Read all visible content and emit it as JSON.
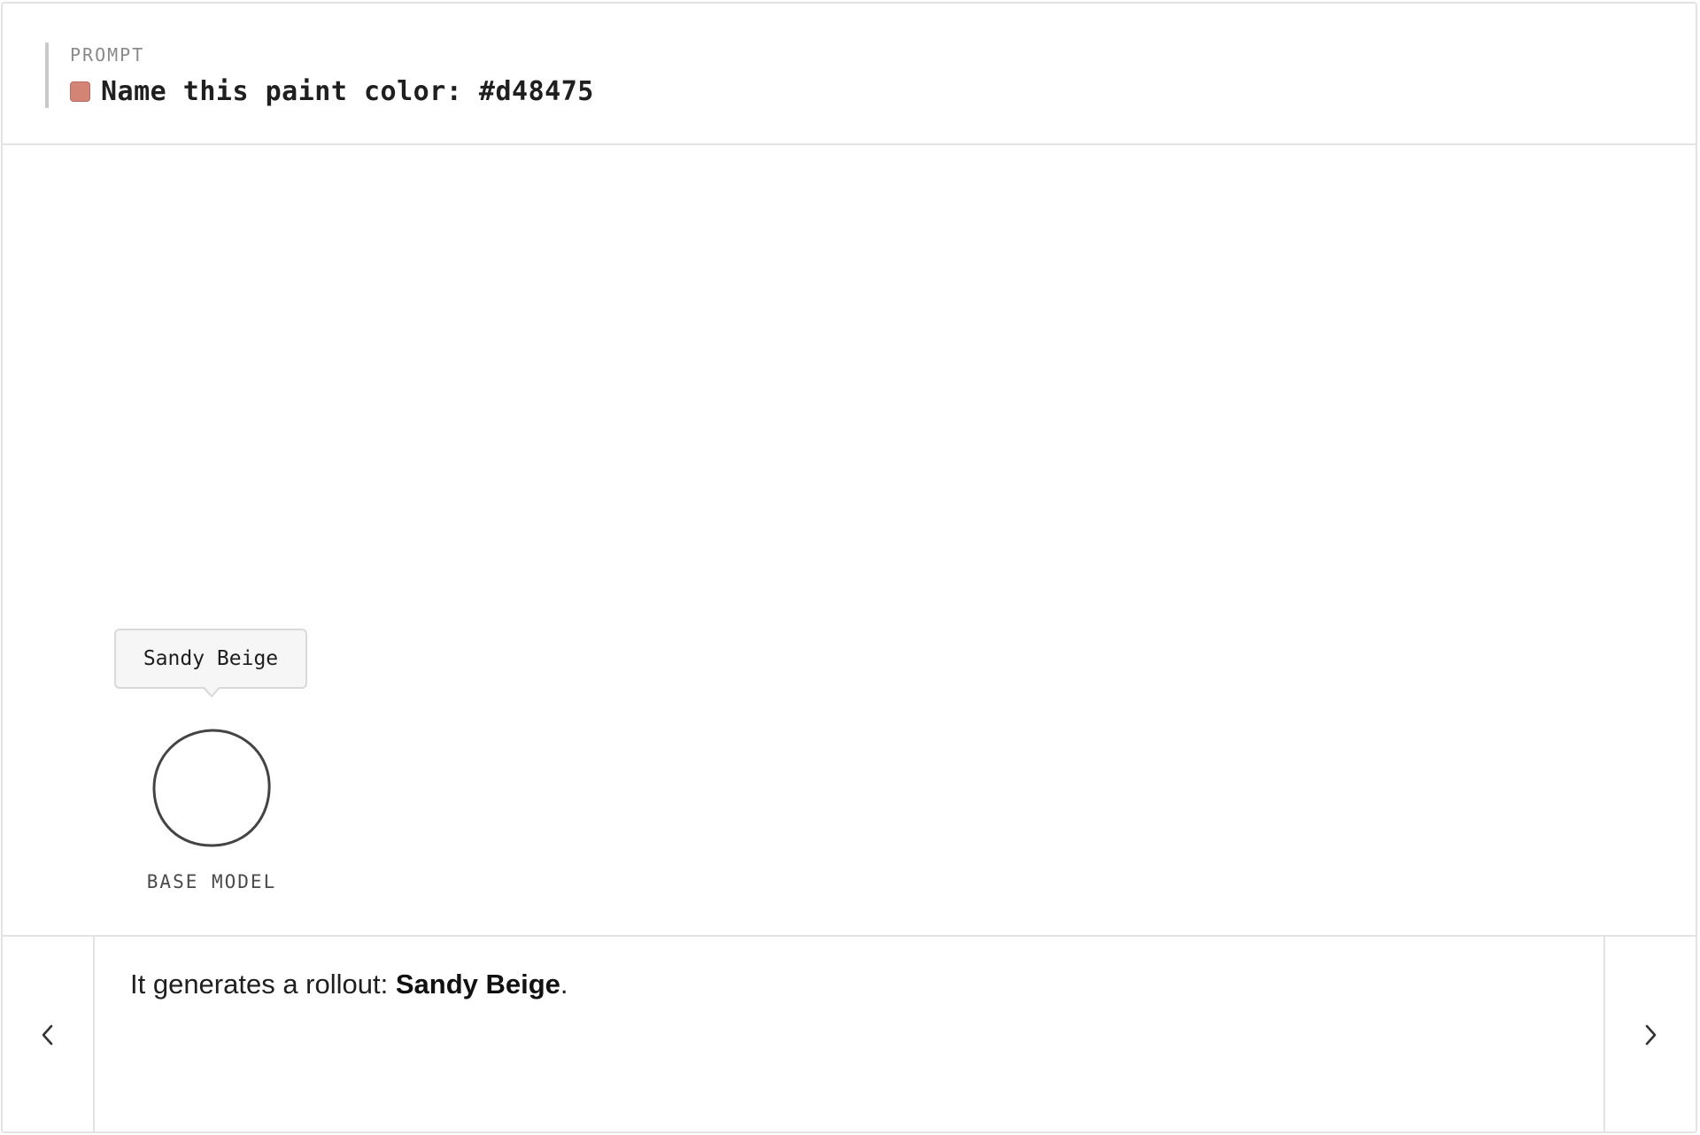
{
  "prompt": {
    "label": "PROMPT",
    "text": "Name this paint color: #d48475",
    "swatch_color": "#d48475",
    "swatch_icon": "color-swatch-icon"
  },
  "canvas": {
    "tooltip_text": "Sandy Beige",
    "node_icon": "base-model-circle-icon",
    "node_label": "BASE MODEL"
  },
  "caption": {
    "prefix": "It generates a rollout: ",
    "highlight": "Sandy Beige",
    "suffix": "."
  },
  "nav": {
    "prev_icon": "chevron-left-icon",
    "next_icon": "chevron-right-icon"
  }
}
